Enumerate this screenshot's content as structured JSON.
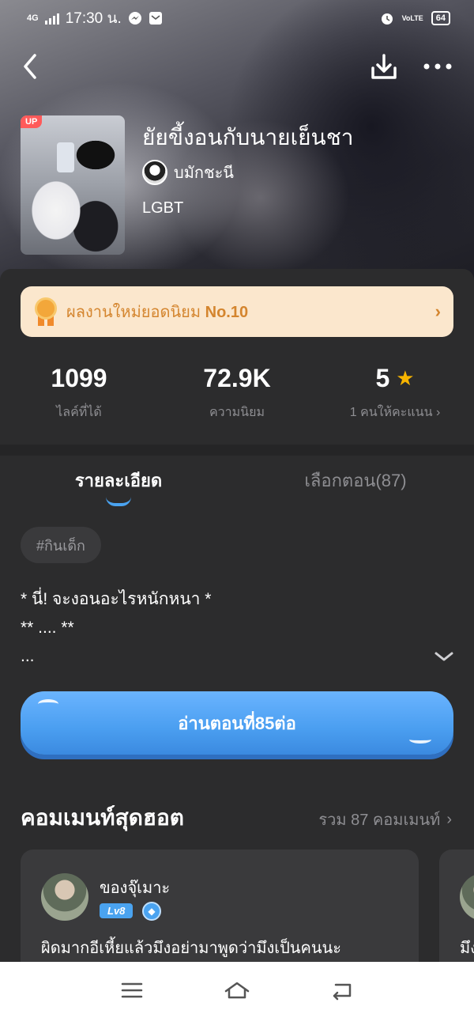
{
  "status_bar": {
    "network": "4G",
    "time": "17:30 น.",
    "volte": "VoLTE",
    "battery": "64"
  },
  "story": {
    "up_badge": "UP",
    "title": "ยัยขี้งอนกับนายเย็นชา",
    "author": "บมักชะนี",
    "genre": "LGBT"
  },
  "banner": {
    "text": "ผลงานใหม่ยอดนิยม",
    "rank": "No.10"
  },
  "stats": [
    {
      "value": "1099",
      "label": "ไลค์ที่ได้"
    },
    {
      "value": "72.9K",
      "label": "ความนิยม"
    },
    {
      "value": "5",
      "label": "1 คนให้คะแนน"
    }
  ],
  "tabs": {
    "details": "รายละเอียด",
    "chapters": "เลือกตอน(87)"
  },
  "tag": "#กินเด็ก",
  "description": {
    "line1": "* นี่! จะงอนอะไรหนักหนา *",
    "line2": "** .... **",
    "line3": "..."
  },
  "read_button": "อ่านตอนที่85ต่อ",
  "hot_comments": {
    "title": "คอมเมนท์สุดฮอต",
    "total": "รวม 87 คอมเมนท์",
    "comments": [
      {
        "user": "ของจุ๊เมาะ",
        "level": "Lv8",
        "text": "ผิดมากอีเหี้ยแล้วมึงอย่ามาพูดว่ามึงเป็นคนนะ"
      },
      {
        "text": "มึง"
      }
    ]
  },
  "colors": {
    "accent": "#4aa3f0",
    "banner_bg": "#fbe7cd",
    "banner_text": "#d4852e",
    "star": "#f7b500",
    "panel_bg": "#2c2c2d"
  }
}
